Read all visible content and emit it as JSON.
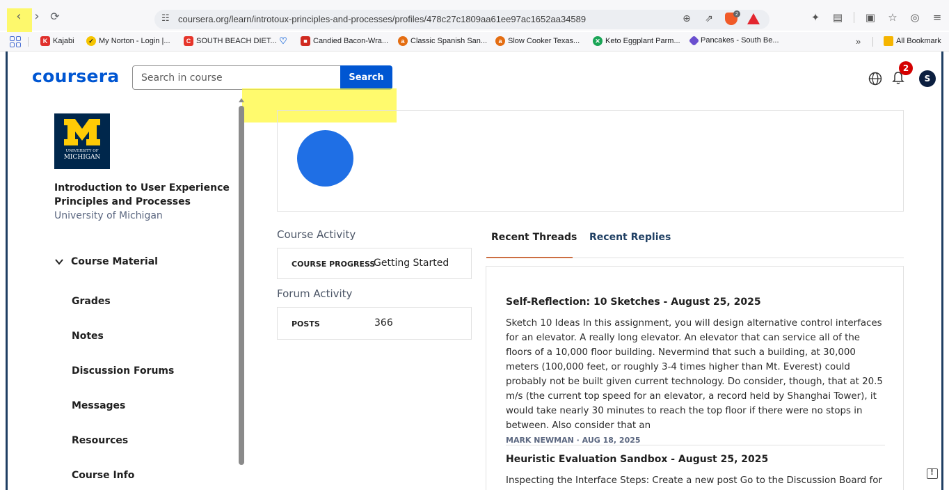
{
  "browser": {
    "url": "coursera.org/learn/introtoux-principles-and-processes/profiles/478c27c1809aa61ee97ac1652aa34589",
    "brave_shield_count": "2",
    "bookmarks": [
      {
        "label": "Kajabi",
        "icon": "kajabi-icon",
        "color": "#e0302c"
      },
      {
        "label": "My Norton - Login |...",
        "icon": "norton-check-icon",
        "color": "#f5c400"
      },
      {
        "label": "SOUTH BEACH DIET...",
        "icon": "south-beach-icon",
        "color": "#e6352b"
      },
      {
        "label": "",
        "icon": "heart-icon",
        "color": "#3d7fe0"
      },
      {
        "label": "Candied Bacon-Wra...",
        "icon": "recipe-icon",
        "color": "#d02a20"
      },
      {
        "label": "Classic Spanish San...",
        "icon": "allrecipes-icon",
        "color": "#e46d12"
      },
      {
        "label": "Slow Cooker Texas...",
        "icon": "allrecipes-icon",
        "color": "#e46d12"
      },
      {
        "label": "Keto Eggplant Parm...",
        "icon": "keto-icon",
        "color": "#1aa556"
      },
      {
        "label": "Pancakes - South Be...",
        "icon": "pancake-icon",
        "color": "#6a4fcf"
      }
    ],
    "overflow_label": "»",
    "all_bookmarks_label": "All Bookmark"
  },
  "header": {
    "logo": "coursera",
    "search_placeholder": "Search in course",
    "search_button": "Search",
    "notifications_count": "2",
    "avatar_initial": "S",
    "brand_color": "#0056d2"
  },
  "sidebar": {
    "university_logo_line1": "UNIVERSITY OF",
    "university_logo_line2": "MICHIGAN",
    "course_title": "Introduction to User Experience Principles and Processes",
    "course_org": "University of Michigan",
    "section_label": "Course Material",
    "items": [
      {
        "label": "Grades"
      },
      {
        "label": "Notes"
      },
      {
        "label": "Discussion Forums"
      },
      {
        "label": "Messages"
      },
      {
        "label": "Resources"
      },
      {
        "label": "Course Info"
      }
    ]
  },
  "profile": {
    "course_activity_title": "Course Activity",
    "course_progress_label": "COURSE PROGRESS",
    "course_progress_value": "Getting Started",
    "forum_activity_title": "Forum Activity",
    "posts_label": "POSTS",
    "posts_value": "366"
  },
  "tabs": [
    {
      "label": "Recent Threads",
      "active": true
    },
    {
      "label": "Recent Replies",
      "active": false
    }
  ],
  "threads": [
    {
      "title": "Self-Reflection: 10 Sketches - August 25, 2025",
      "body": "Sketch 10 Ideas In this assignment, you will design alternative control interfaces for an elevator. A really long elevator. An elevator that can service all of the floors of a 10,000 floor building. Nevermind that such a building, at 30,000 meters (100,000 feet, or roughly 3-4 times higher than Mt. Everest) could probably not be built given current technology. Do consider, though, that at 20.5 m/s (the current top speed for an elevator, a record held by Shanghai Tower), it would take nearly 30 minutes to reach the top floor if there were no stops in between. Also consider that an",
      "meta": "MARK NEWMAN · AUG 18, 2025"
    },
    {
      "title": "Heuristic Evaluation Sandbox - August 25, 2025",
      "body": "Inspecting the Interface Steps: Create a new post Go to the Discussion Board for"
    }
  ]
}
